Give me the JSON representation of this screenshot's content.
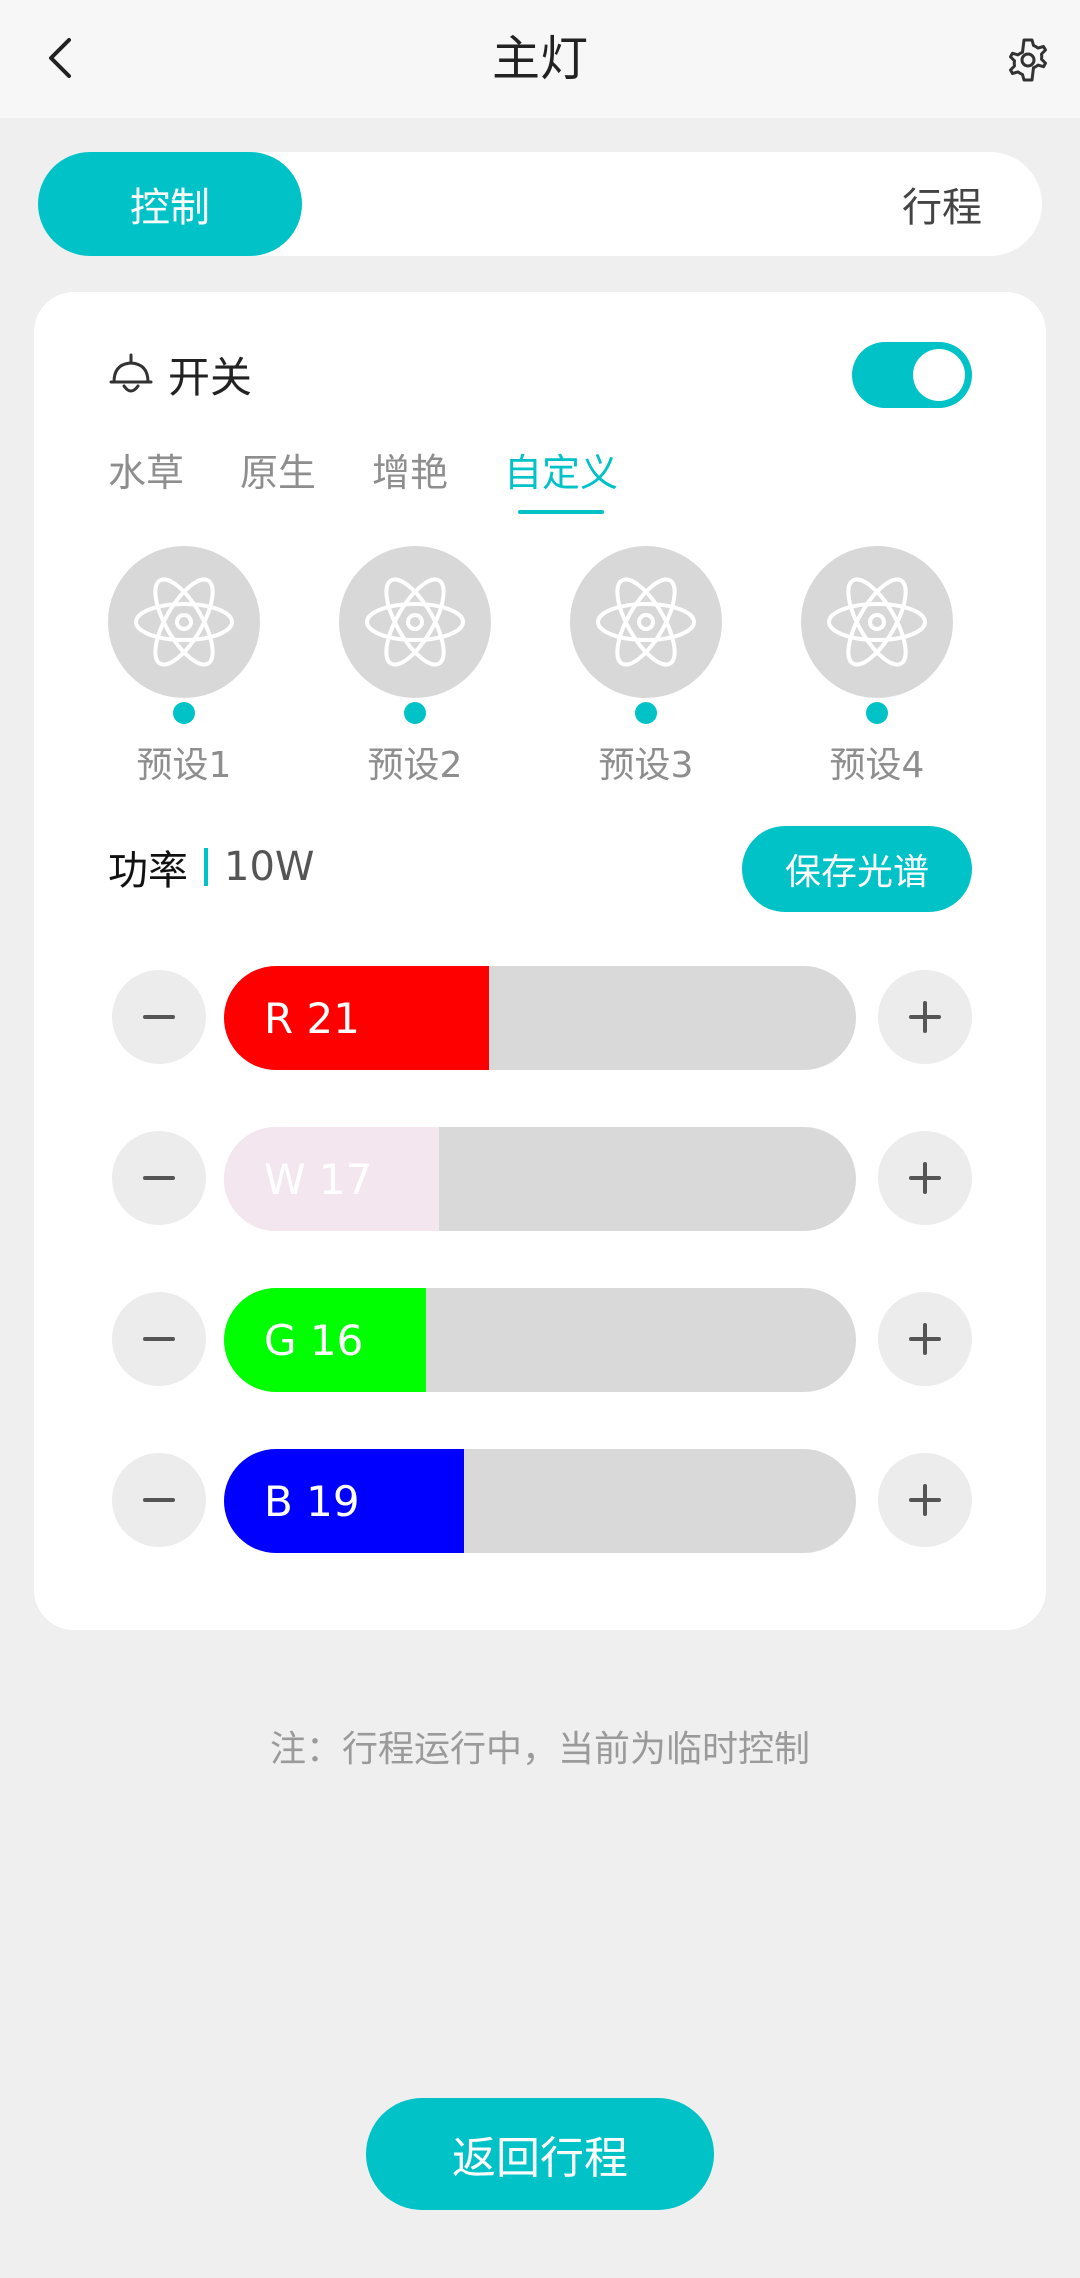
{
  "header": {
    "title": "主灯",
    "back_icon": "chevron-left-icon",
    "settings_icon": "gear-icon"
  },
  "tabs": [
    {
      "label": "控制",
      "active": true
    },
    {
      "label": "行程",
      "active": false
    }
  ],
  "switch": {
    "label": "开关",
    "icon": "lamp-icon",
    "on": true,
    "accent": "#00c2c7"
  },
  "modes": [
    {
      "label": "水草",
      "active": false
    },
    {
      "label": "原生",
      "active": false
    },
    {
      "label": "增艳",
      "active": false
    },
    {
      "label": "自定义",
      "active": true
    }
  ],
  "presets": [
    {
      "label": "预设1",
      "icon": "atom-icon"
    },
    {
      "label": "预设2",
      "icon": "atom-icon"
    },
    {
      "label": "预设3",
      "icon": "atom-icon"
    },
    {
      "label": "预设4",
      "icon": "atom-icon"
    }
  ],
  "power": {
    "label": "功率",
    "value": "10W"
  },
  "save_label": "保存光谱",
  "channels": [
    {
      "label": "R 21",
      "value": 21,
      "fill_fraction": 0.42,
      "color": "#ff0000",
      "text_color": "#ffffff"
    },
    {
      "label": "W 17",
      "value": 17,
      "fill_fraction": 0.34,
      "color": "#f3e6ef",
      "text_color": "#ffffff"
    },
    {
      "label": "G 16",
      "value": 16,
      "fill_fraction": 0.32,
      "color": "#00ff00",
      "text_color": "#ffffff"
    },
    {
      "label": "B 19",
      "value": 19,
      "fill_fraction": 0.38,
      "color": "#0000ff",
      "text_color": "#ffffff"
    }
  ],
  "note": "注：行程运行中，当前为临时控制",
  "return_label": "返回行程"
}
